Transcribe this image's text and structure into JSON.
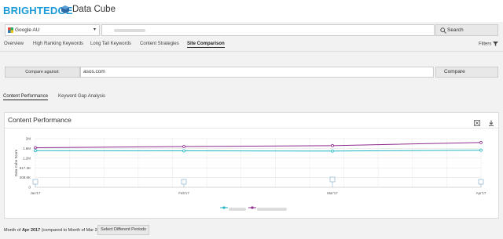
{
  "header": {
    "logo": "BRIGHTEDGE",
    "app_name": "Data Cube"
  },
  "search": {
    "site": "Google AU",
    "domain_value": "",
    "search_label": "Search"
  },
  "nav": {
    "tabs": [
      {
        "label": "Overview",
        "active": false
      },
      {
        "label": "High Ranking Keywords",
        "active": false
      },
      {
        "label": "Long Tail Keywords",
        "active": false
      },
      {
        "label": "Content Strategies",
        "active": false
      },
      {
        "label": "Site Comparison",
        "active": true
      }
    ],
    "filters_label": "Filters"
  },
  "compare": {
    "label": "Compare against:",
    "value": "asos.com",
    "button": "Compare"
  },
  "subtabs": [
    {
      "label": "Content Performance",
      "active": true
    },
    {
      "label": "Keyword Gap Analysis",
      "active": false
    }
  ],
  "panel": {
    "title": "Content Performance"
  },
  "chart_data": {
    "type": "line",
    "ylabel": "Data Cube Score",
    "x": [
      "Jan'17",
      "Feb'17",
      "Mar'17",
      "Apr'17"
    ],
    "y_ticks": [
      "0",
      "408.6K",
      "817.3K",
      "1.2M",
      "1.6M",
      "2M"
    ],
    "ylim": [
      0,
      2040000
    ],
    "grid": true,
    "series": [
      {
        "name": "",
        "color": "#1fb5c4",
        "values": [
          1540000,
          1530000,
          1520000,
          1560000
        ]
      },
      {
        "name": "",
        "color": "#8e2a8e",
        "values": [
          1660000,
          1710000,
          1750000,
          1880000
        ]
      }
    ],
    "legend_position": "bottom"
  },
  "footer": {
    "prefix": "Month of",
    "month": "Apr 2017",
    "suffix": "(compared to Month of Mar 2017)",
    "button": "Select Different Periods"
  }
}
